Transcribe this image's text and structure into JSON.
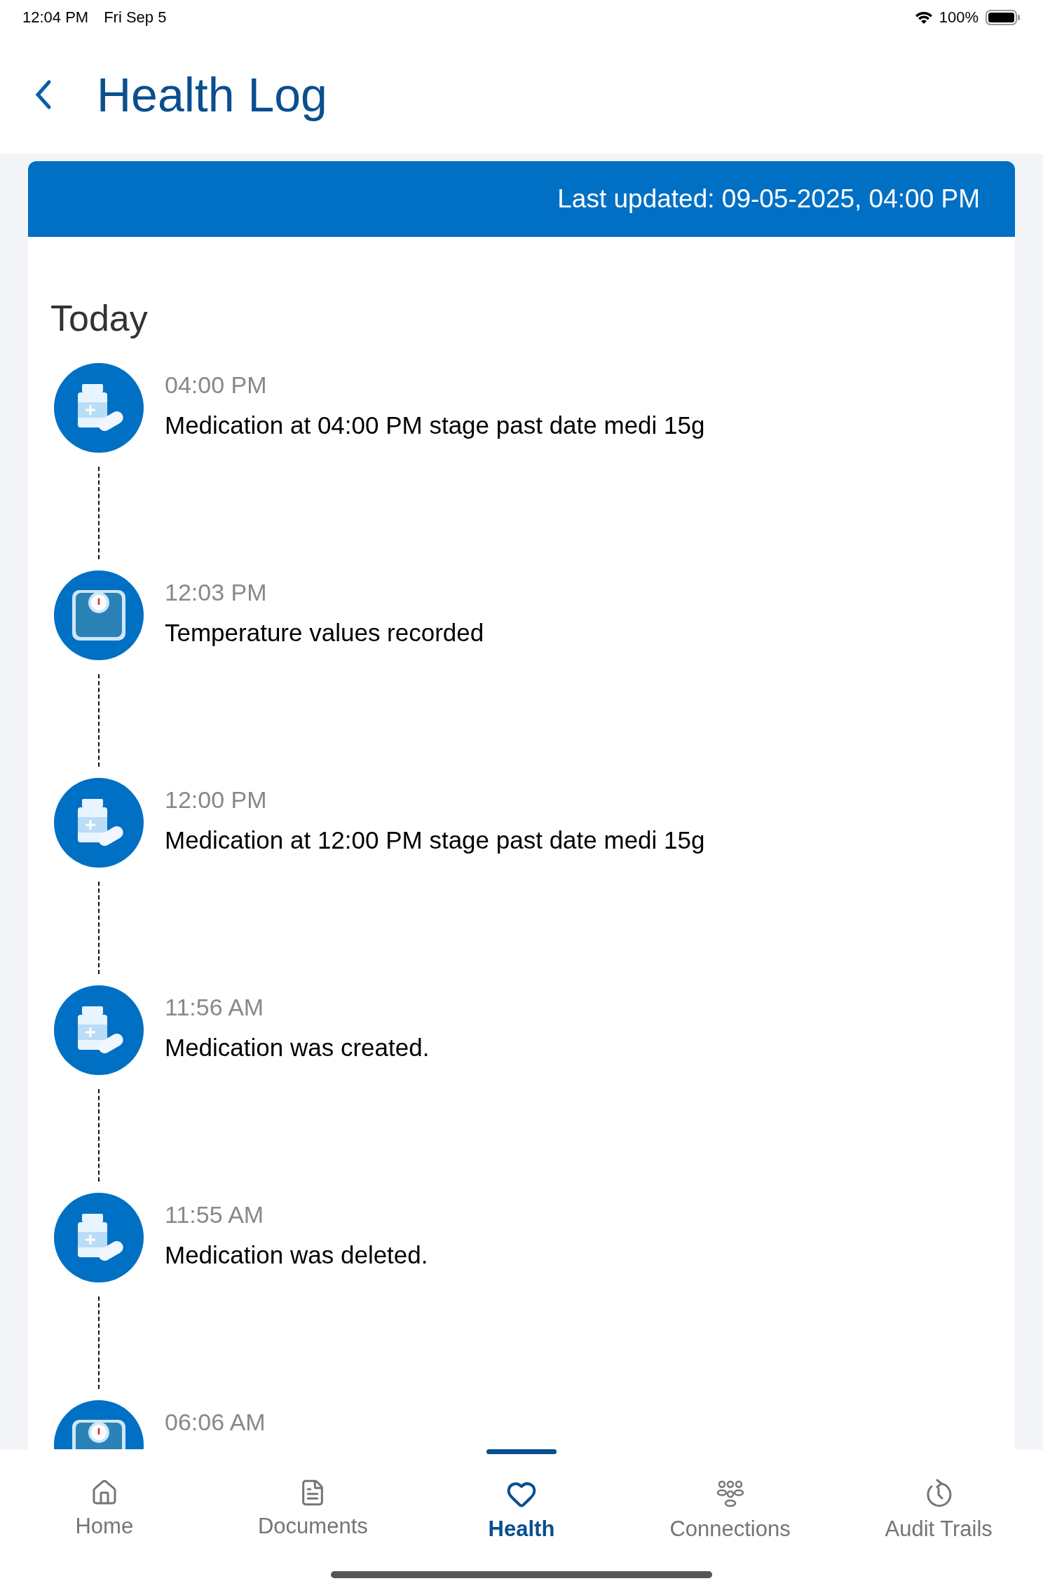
{
  "status_bar": {
    "time": "12:04 PM",
    "date": "Fri Sep 5",
    "battery": "100%"
  },
  "header": {
    "title": "Health Log"
  },
  "banner": {
    "text": "Last updated: 09-05-2025, 04:00 PM"
  },
  "section": {
    "title": "Today"
  },
  "entries": [
    {
      "kind": "medication",
      "time": "04:00 PM",
      "description": "Medication at 04:00 PM stage past date medi 15g"
    },
    {
      "kind": "scale",
      "time": "12:03 PM",
      "description": "Temperature values recorded"
    },
    {
      "kind": "medication",
      "time": "12:00 PM",
      "description": "Medication at 12:00 PM stage past date medi 15g"
    },
    {
      "kind": "medication",
      "time": "11:56 AM",
      "description": "Medication was created."
    },
    {
      "kind": "medication",
      "time": "11:55 AM",
      "description": "Medication was deleted."
    },
    {
      "kind": "scale",
      "time": "06:06 AM"
    }
  ],
  "nav": [
    {
      "kind": "home",
      "label": "Home",
      "selected": false
    },
    {
      "kind": "documents",
      "label": "Documents",
      "selected": false
    },
    {
      "kind": "health",
      "label": "Health",
      "selected": true
    },
    {
      "kind": "connections",
      "label": "Connections",
      "selected": false
    },
    {
      "kind": "audit",
      "label": "Audit Trails",
      "selected": false
    }
  ]
}
